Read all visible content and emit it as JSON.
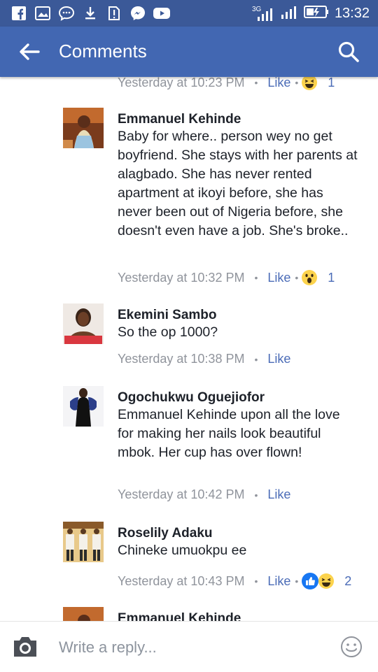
{
  "status_bar": {
    "network": "3G",
    "time": "13:32"
  },
  "header": {
    "title": "Comments"
  },
  "top_partial": {
    "time": "Yesterday at 10:23 PM",
    "like": "Like",
    "reaction_count": "1"
  },
  "comments": [
    {
      "name": "Emmanuel Kehinde",
      "text": "Baby for where..  person wey no get boyfriend. She stays with her parents at alagbado. She has never rented apartment at ikoyi before, she has never been out of Nigeria before, she doesn't even have a job. She's broke..",
      "time": "Yesterday at 10:32 PM",
      "like": "Like",
      "reaction_count": "1"
    },
    {
      "name": "Ekemini Sambo",
      "text": "So the op 1000?",
      "time": "Yesterday at 10:38 PM",
      "like": "Like"
    },
    {
      "name": "Ogochukwu Oguejiofor",
      "text": "Emmanuel Kehinde upon all the love for making her nails look beautiful mbok. Her cup has over flown!",
      "time": "Yesterday at 10:42 PM",
      "like": "Like"
    },
    {
      "name": "Roselily Adaku",
      "text": "Chineke umuokpu ee",
      "time": "Yesterday at 10:43 PM",
      "like": "Like",
      "reaction_count": "2"
    },
    {
      "name": "Emmanuel Kehinde"
    }
  ],
  "composer": {
    "placeholder": "Write a reply..."
  },
  "colors": {
    "status_bar": "#3b5998",
    "app_bar": "#4267b2",
    "like_link": "#4b6cb7",
    "meta_grey": "#90949c"
  }
}
